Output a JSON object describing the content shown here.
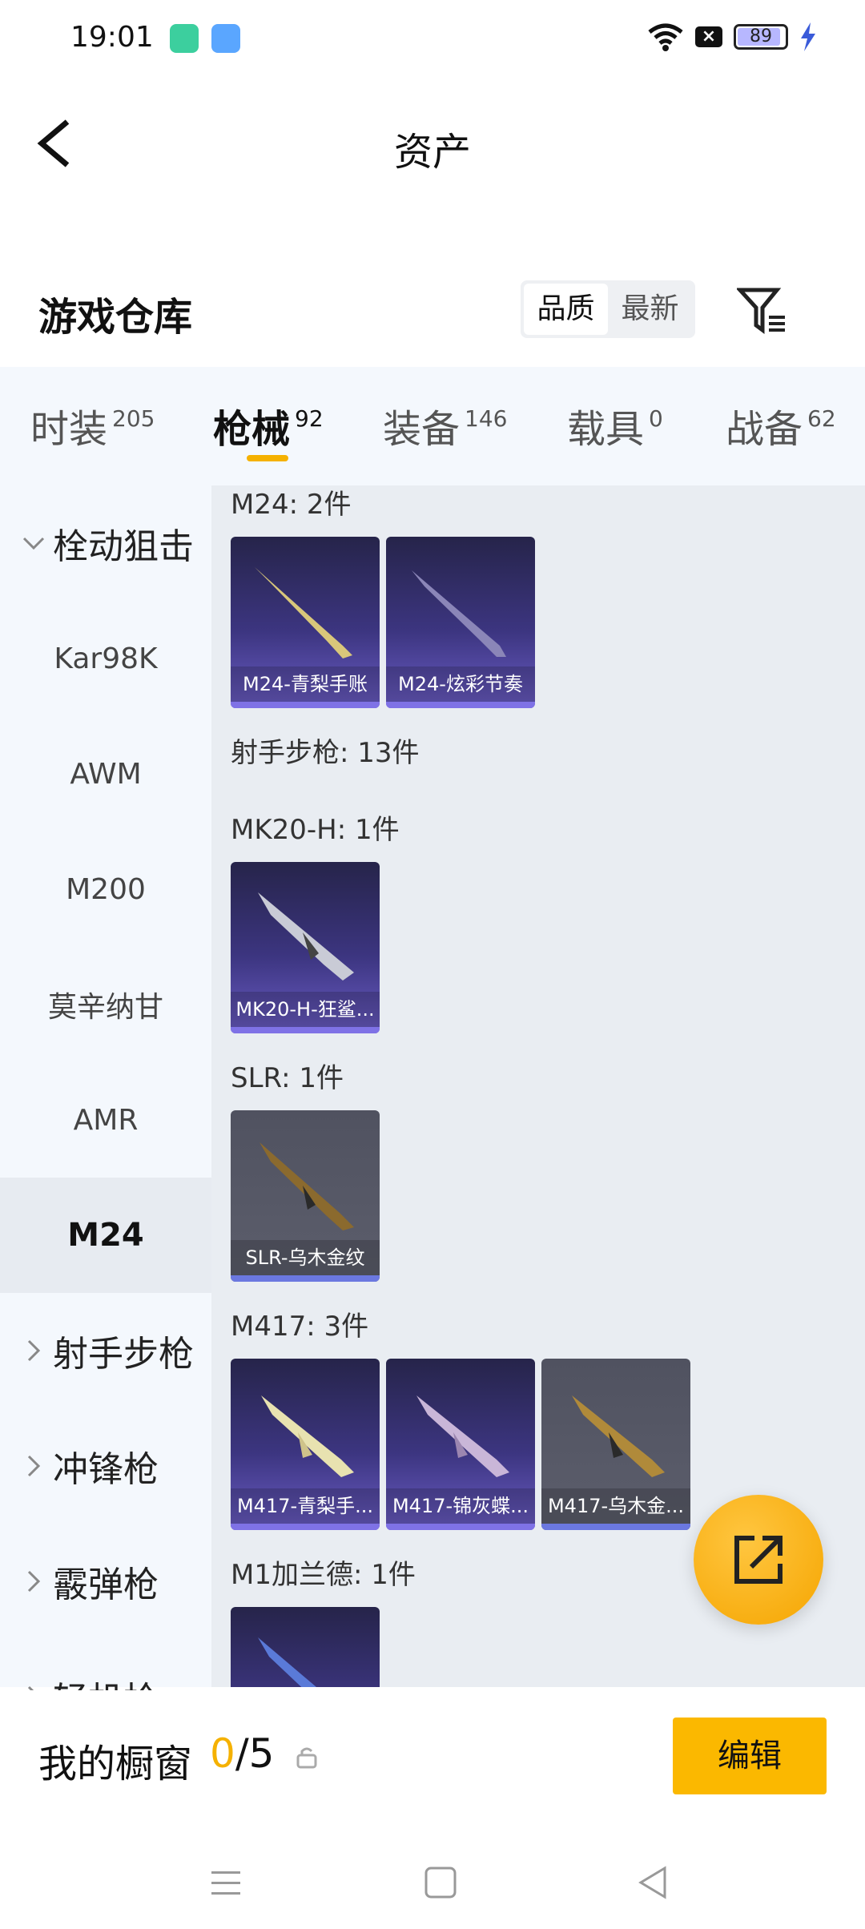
{
  "status_bar": {
    "time": "19:01",
    "battery": "89"
  },
  "header": {
    "title": "资产"
  },
  "warehouse": {
    "title": "游戏仓库",
    "sort_options": [
      "品质",
      "最新"
    ],
    "active_sort": "品质"
  },
  "tabs": [
    {
      "label": "时装",
      "count": "205"
    },
    {
      "label": "枪械",
      "count": "92",
      "active": true
    },
    {
      "label": "装备",
      "count": "146"
    },
    {
      "label": "载具",
      "count": "0"
    },
    {
      "label": "战备",
      "count": "62"
    }
  ],
  "sidebar": {
    "group_open": "栓动狙击",
    "items": [
      "Kar98K",
      "AWM",
      "M200",
      "莫辛纳甘",
      "AMR",
      "M24"
    ],
    "active_item": "M24",
    "groups_closed": [
      "射手步枪",
      "冲锋枪",
      "霰弹枪",
      "轻机枪"
    ]
  },
  "sections": {
    "m24": {
      "label": "M24: 2件",
      "cards": [
        "M24-青梨手账",
        "M24-炫彩节奏"
      ]
    },
    "dmr_header": {
      "label": "射手步枪: 13件"
    },
    "mk20": {
      "label": "MK20-H: 1件",
      "cards": [
        "MK20-H-狂鲨..."
      ]
    },
    "slr": {
      "label": "SLR: 1件",
      "cards": [
        "SLR-乌木金纹"
      ]
    },
    "m417": {
      "label": "M417: 3件",
      "cards": [
        "M417-青梨手...",
        "M417-锦灰蝶...",
        "M417-乌木金..."
      ]
    },
    "m1": {
      "label": "M1加兰德: 1件"
    }
  },
  "showcase": {
    "title": "我的橱窗",
    "current": "0",
    "total": "/5",
    "edit_label": "编辑"
  },
  "colors": {
    "accent": "#fbb800",
    "card_purple": "#3c3580",
    "card_gray": "#505260"
  }
}
